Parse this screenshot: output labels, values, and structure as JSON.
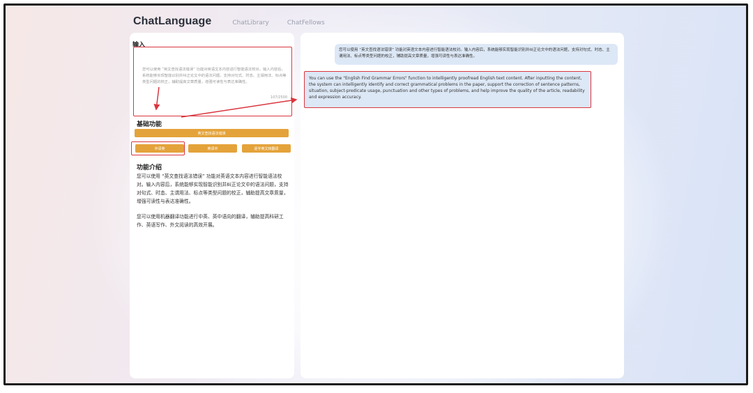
{
  "nav": {
    "logo": "ChatLanguage",
    "links": [
      "ChatLibrary",
      "ChatFellows"
    ]
  },
  "input": {
    "title": "输入",
    "value": "您可以使用 “英文查找语法错误” 功能对英语文本内容进行智能语法校对。输入内容后，系统能够实现智能识别并纠正论文中的语法问题，支持对句式、时态、主谓用法、标点等类型问题的校正，辅助提高文章质量，增强可读性与表达准确性。",
    "counter": "107/2500"
  },
  "basic": {
    "title": "基础功能",
    "buttons": {
      "main": "英文查找语法错误",
      "zh_en": "中译英",
      "en_zh": "英译中",
      "free": "逐字英文转翻译"
    }
  },
  "intro": {
    "title": "功能介绍",
    "p1": "您可以使用 “英文查找语法错误” 功能对英语文本内容进行智能语法校对。输入内容后，系统能够实现智能识别并纠正论文中的语法问题，支持对句式、时态、主谓用法、标点等类型问题的校正，辅助提高文章质量，增强可读性与表达准确性。",
    "p2": "您可以使用机器翻译功能进行中英、英中语向的翻译，辅助提高科研工作、英语写作、外文阅读的高效开展。"
  },
  "chat": {
    "user_message": "您可以使用 “英文查找语法错误” 功能对英语文本内容进行智能语法校对。输入内容后，系统能够实现智能识别并纠正论文中的语法问题，支持对句式、时态、主谓用法、标点等类型问题的校正，辅助提高文章质量，增强可读性与表达准确性。",
    "bot_message": "You can use the \"English Find Grammar Errors\" function to intelligently proofread English text content. After inputting the content, the system can intelligently identify and correct grammatical problems in the paper, support the correction of sentence patterns, situation, subject-predicate usage, punctuation and other types of problems, and help improve the quality of the article, readability and expression accuracy."
  },
  "colors": {
    "accent": "#e4a33a",
    "annotation": "#d9363e",
    "bubble": "#dde8f6"
  }
}
